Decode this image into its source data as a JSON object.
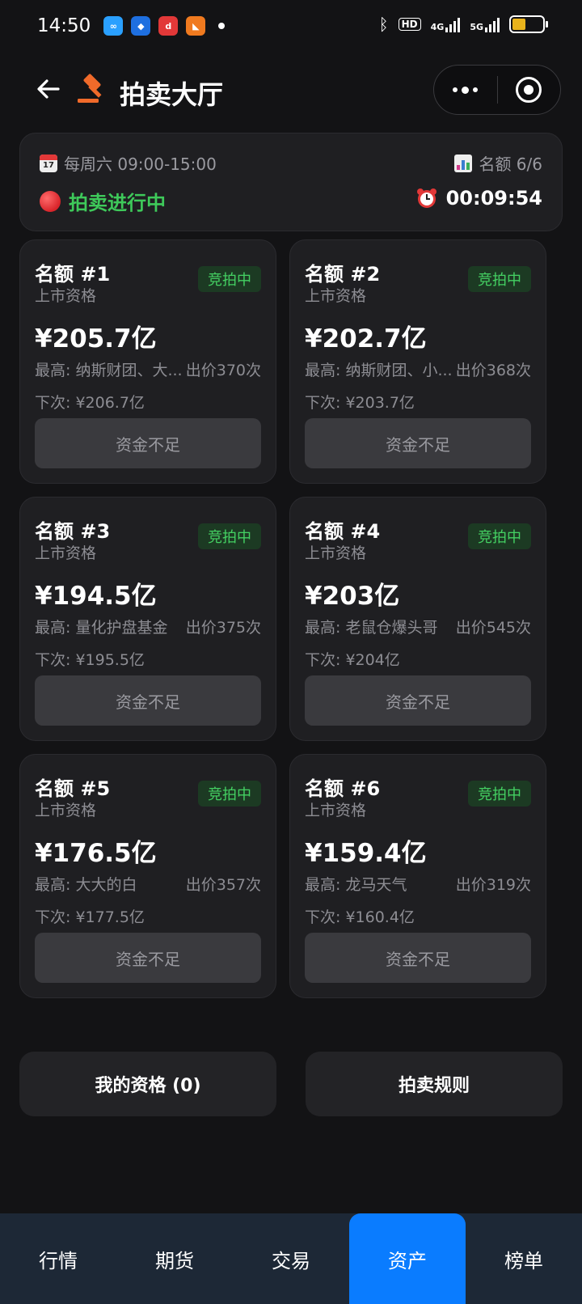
{
  "status_bar": {
    "time": "14:50",
    "icons": [
      "cloud-app-icon",
      "blue-app-icon",
      "red-app-icon",
      "orange-app-icon"
    ],
    "hd_label": "HD",
    "net1": "4G",
    "net2": "5G",
    "battery_level": 0.45
  },
  "header": {
    "title": "拍卖大厅"
  },
  "info": {
    "schedule": "每周六 09:00-15:00",
    "calendar_day": "17",
    "quota": "名额 6/6",
    "status": "拍卖进行中",
    "timer": "00:09:54"
  },
  "cards": [
    {
      "title": "名额 #1",
      "sub": "上市资格",
      "badge": "竞拍中",
      "price": "¥205.7亿",
      "high": "最高: 纳斯财团、大...",
      "bids": "出价370次",
      "next": "下次: ¥206.7亿",
      "button": "资金不足"
    },
    {
      "title": "名额 #2",
      "sub": "上市资格",
      "badge": "竞拍中",
      "price": "¥202.7亿",
      "high": "最高: 纳斯财团、小...",
      "bids": "出价368次",
      "next": "下次: ¥203.7亿",
      "button": "资金不足"
    },
    {
      "title": "名额 #3",
      "sub": "上市资格",
      "badge": "竞拍中",
      "price": "¥194.5亿",
      "high": "最高: 量化护盘基金",
      "bids": "出价375次",
      "next": "下次: ¥195.5亿",
      "button": "资金不足"
    },
    {
      "title": "名额 #4",
      "sub": "上市资格",
      "badge": "竞拍中",
      "price": "¥203亿",
      "high": "最高: 老鼠仓爆头哥",
      "bids": "出价545次",
      "next": "下次: ¥204亿",
      "button": "资金不足"
    },
    {
      "title": "名额 #5",
      "sub": "上市资格",
      "badge": "竞拍中",
      "price": "¥176.5亿",
      "high": "最高: 大大的白",
      "bids": "出价357次",
      "next": "下次: ¥177.5亿",
      "button": "资金不足"
    },
    {
      "title": "名额 #6",
      "sub": "上市资格",
      "badge": "竞拍中",
      "price": "¥159.4亿",
      "high": "最高: 龙马天气",
      "bids": "出价319次",
      "next": "下次: ¥160.4亿",
      "button": "资金不足"
    }
  ],
  "actions": {
    "my_qualification": "我的资格 (0)",
    "rules": "拍卖规则"
  },
  "tabs": [
    {
      "label": "行情",
      "active": false
    },
    {
      "label": "期货",
      "active": false
    },
    {
      "label": "交易",
      "active": false
    },
    {
      "label": "资产",
      "active": true
    },
    {
      "label": "榜单",
      "active": false
    }
  ],
  "colors": {
    "background": "#131315",
    "card": "#1f1f22",
    "accent_green": "#3ec95a",
    "tab_active": "#0a7cff",
    "tabbar": "#1d2836",
    "hammer": "#f06a2a"
  }
}
